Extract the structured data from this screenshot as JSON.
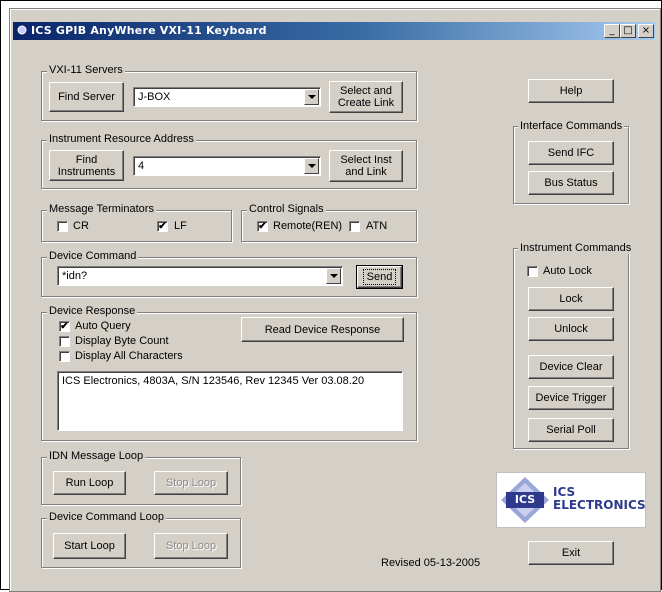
{
  "window": {
    "title": "ICS GPIB AnyWhere VXI-11 Keyboard",
    "minimize": "_",
    "maximize": "□",
    "close": "×"
  },
  "vxi_servers": {
    "legend": "VXI-11 Servers",
    "find_label": "Find Server",
    "value": "J-BOX",
    "select_label": "Select and Create Link"
  },
  "instrument_address": {
    "legend": "Instrument Resource  Address",
    "find_label": "Find Instruments",
    "value": "4",
    "select_label": "Select Inst and Link"
  },
  "terminators": {
    "legend": "Message Terminators",
    "cr": {
      "label": "CR",
      "checked": false
    },
    "lf": {
      "label": "LF",
      "checked": true
    }
  },
  "control_signals": {
    "legend": "Control Signals",
    "remote": {
      "label": "Remote(REN)",
      "checked": true
    },
    "atn": {
      "label": "ATN",
      "checked": false
    }
  },
  "device_command": {
    "legend": "Device Command",
    "value": "*idn?",
    "send_label": "Send"
  },
  "device_response": {
    "legend": "Device Response",
    "auto_query": {
      "label": "Auto Query",
      "checked": true
    },
    "byte_count": {
      "label": "Display Byte Count",
      "checked": false
    },
    "all_chars": {
      "label": "Display All Characters",
      "checked": false
    },
    "read_label": "Read Device Response",
    "response_text": "ICS Electronics, 4803A, S/N 123546, Rev 12345 Ver 03.08.20"
  },
  "idn_loop": {
    "legend": "IDN Message Loop",
    "run_label": "Run Loop",
    "stop_label": "Stop Loop"
  },
  "cmd_loop": {
    "legend": "Device Command Loop",
    "start_label": "Start Loop",
    "stop_label": "Stop Loop"
  },
  "revised": "Revised 05-13-2005",
  "help_label": "Help",
  "interface_commands": {
    "legend": "Interface Commands",
    "send_ifc_label": "Send IFC",
    "bus_status_label": "Bus Status"
  },
  "instrument_commands": {
    "legend": "Instrument Commands",
    "auto_lock": {
      "label": "Auto Lock",
      "checked": false
    },
    "lock_label": "Lock",
    "unlock_label": "Unlock",
    "clear_label": "Device Clear",
    "trigger_label": "Device Trigger",
    "serial_poll_label": "Serial Poll"
  },
  "logo": {
    "badge": "ICS",
    "line1": "ICS",
    "line2": "ELECTRONICS"
  },
  "exit_label": "Exit",
  "check_glyph": "✔",
  "colors": {
    "face": "#d4d0c8",
    "title_start": "#0a246a",
    "title_end": "#a6caf0",
    "logo_blue": "#2e3a8c"
  }
}
